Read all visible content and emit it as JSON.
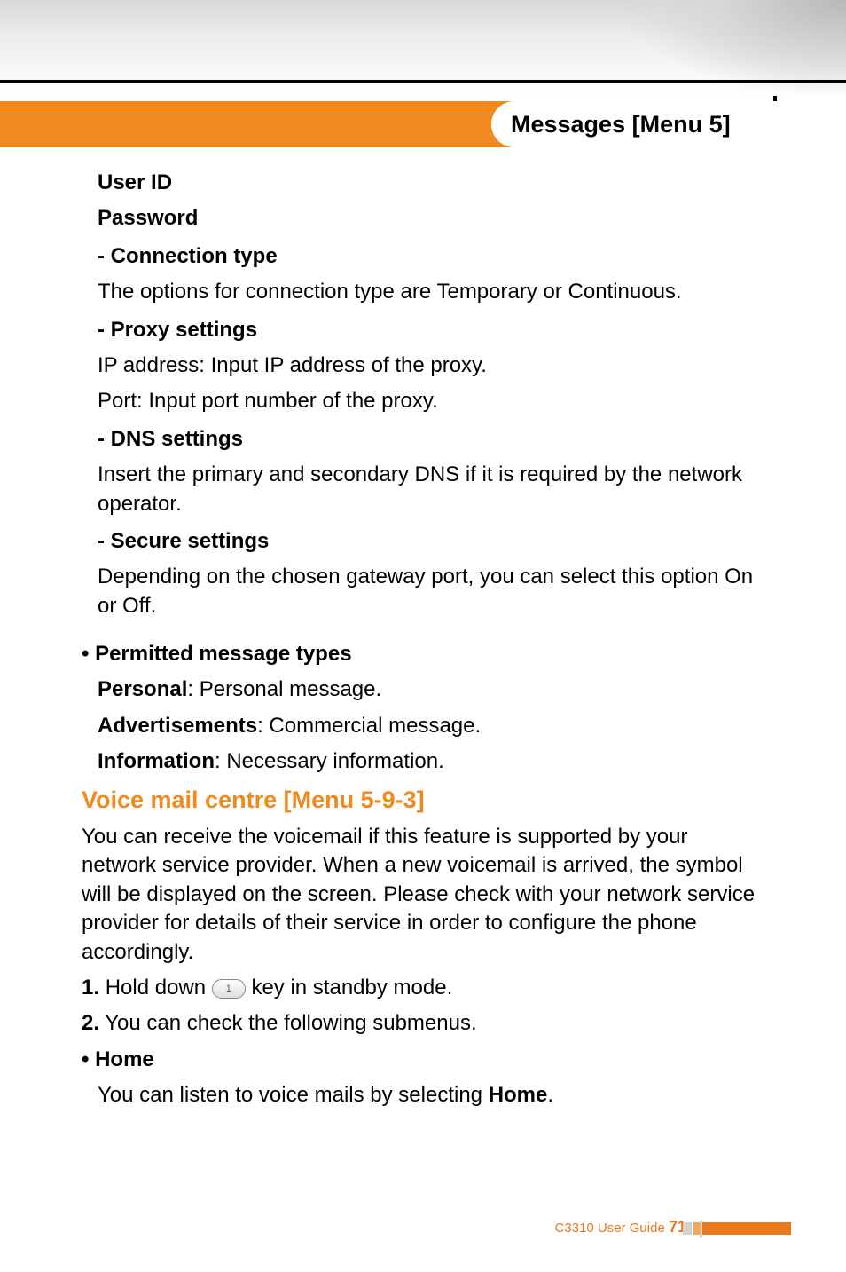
{
  "header": {
    "title": "Messages [Menu 5]"
  },
  "body": {
    "user_id_label": "User ID",
    "password_label": "Password",
    "conn": {
      "heading": "- Connection type",
      "text": "The options for connection type are Temporary or Continuous."
    },
    "proxy": {
      "heading": "- Proxy settings",
      "ip": "IP address: Input IP address of the proxy.",
      "port": "Port: Input port number of the proxy."
    },
    "dns": {
      "heading": "- DNS settings",
      "text": "Insert the primary and secondary DNS if it is required by the network operator."
    },
    "secure": {
      "heading": "- Secure settings",
      "text": "Depending on the chosen gateway port, you can select this option On or Off."
    },
    "permitted": {
      "heading": "• Permitted message types",
      "personal_label": "Personal",
      "personal_text": ": Personal message.",
      "ads_label": "Advertisements",
      "ads_text": ": Commercial message.",
      "info_label": "Information",
      "info_text": ": Necessary information."
    },
    "voice": {
      "heading": "Voice mail centre [Menu 5-9-3]",
      "intro": "You can receive the voicemail if this feature is supported by your network service provider. When a new voicemail is arrived, the symbol will be displayed on the screen. Please check with your network service provider for details of their service in order to configure the phone accordingly.",
      "step1_num": "1.",
      "step1_a": "Hold down ",
      "step1_b": " key in standby mode.",
      "keycap": "1",
      "step2_num": "2.",
      "step2": "You can check the following submenus.",
      "home_heading": "• Home",
      "home_text_a": "You can listen to voice mails by selecting ",
      "home_text_bold": "Home",
      "home_text_c": "."
    }
  },
  "footer": {
    "guide": "C3310 User Guide",
    "page": "71"
  }
}
